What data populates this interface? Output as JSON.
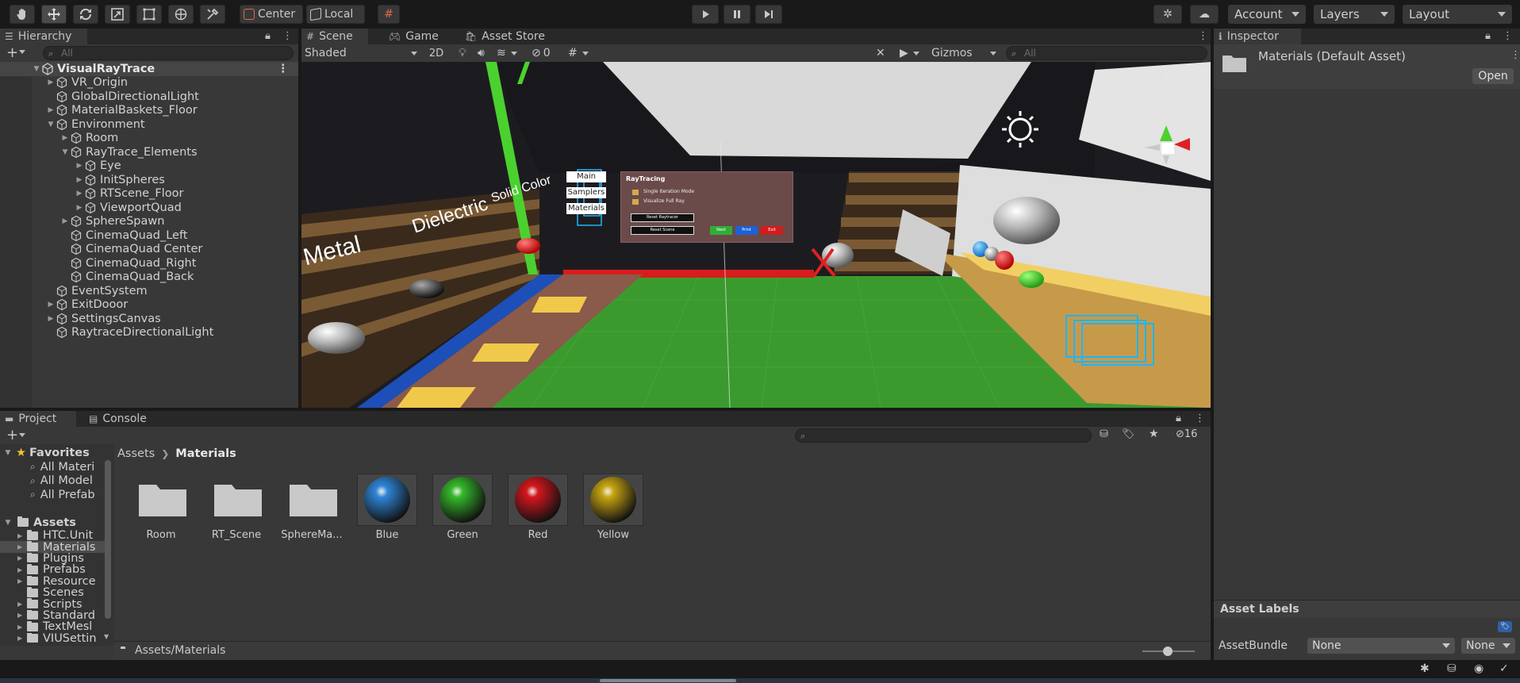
{
  "toolbar": {
    "pivot_label": "Center",
    "space_label": "Local",
    "account_label": "Account",
    "layers_label": "Layers",
    "layout_label": "Layout"
  },
  "hierarchy": {
    "tab_label": "Hierarchy",
    "search_placeholder": "All",
    "root": "VisualRayTrace",
    "items": [
      "VR_Origin",
      "GlobalDirectionalLight",
      "MaterialBaskets_Floor",
      "Environment",
      "Room",
      "RayTrace_Elements",
      "Eye",
      "InitSpheres",
      "RTScene_Floor",
      "ViewportQuad",
      "SphereSpawn",
      "CinemaQuad_Left",
      "CinemaQuad Center",
      "CinemaQuad_Right",
      "CinemaQuad_Back",
      "EventSystem",
      "ExitDooor",
      "SettingsCanvas",
      "RaytraceDirectionalLight"
    ]
  },
  "scene": {
    "tabs": [
      "Scene",
      "Game",
      "Asset Store"
    ],
    "shading_mode": "Shaded",
    "mode_2d": "2D",
    "hidden_count": "0",
    "gizmos_label": "Gizmos",
    "search_placeholder": "All",
    "gizmo_axis_y": "y",
    "gizmo_axis_x": "x",
    "wall_labels": [
      "Metal",
      "Dielectric",
      "Solid Color"
    ],
    "menu_buttons": [
      "Main",
      "Samplers",
      "Materials"
    ],
    "raytracing_panel": {
      "title": "RayTracing",
      "options": [
        "Single Iteration Mode",
        "Visualize Full Ray"
      ],
      "reset_button": "Reset Raytracer",
      "second_button": "Reset Scene",
      "color_buttons": [
        "Next",
        "Print",
        "Exit"
      ]
    }
  },
  "project": {
    "tabs": [
      "Project",
      "Console"
    ],
    "hidden_count": "16",
    "favorites_label": "Favorites",
    "favorites": [
      "All Materi",
      "All Model",
      "All Prefab"
    ],
    "assets_label": "Assets",
    "asset_folders": [
      "HTC.Unit",
      "Materials",
      "Plugins",
      "Prefabs",
      "Resource",
      "Scenes",
      "Scripts",
      "Standard",
      "TextMesl",
      "VIUSettin"
    ],
    "breadcrumb": [
      "Assets",
      "Materials"
    ],
    "items": [
      {
        "name": "Room",
        "kind": "folder"
      },
      {
        "name": "RT_Scene",
        "kind": "folder"
      },
      {
        "name": "SphereMa...",
        "kind": "folder"
      },
      {
        "name": "Blue",
        "kind": "material",
        "color": "#2f86d8"
      },
      {
        "name": "Green",
        "kind": "material",
        "color": "#36b92a"
      },
      {
        "name": "Red",
        "kind": "material",
        "color": "#d5161d"
      },
      {
        "name": "Yellow",
        "kind": "material",
        "color": "#c8a512"
      }
    ],
    "footer_path": "Assets/Materials"
  },
  "inspector": {
    "tab_label": "Inspector",
    "title": "Materials (Default Asset)",
    "open_button": "Open",
    "asset_labels_title": "Asset Labels",
    "assetbundle_label": "AssetBundle",
    "assetbundle_value": "None",
    "variant_value": "None"
  },
  "colors": {
    "panel_bg": "#383838",
    "tab_bg": "#282828",
    "app_bg": "#191919",
    "selection": "#4d4d4d"
  }
}
